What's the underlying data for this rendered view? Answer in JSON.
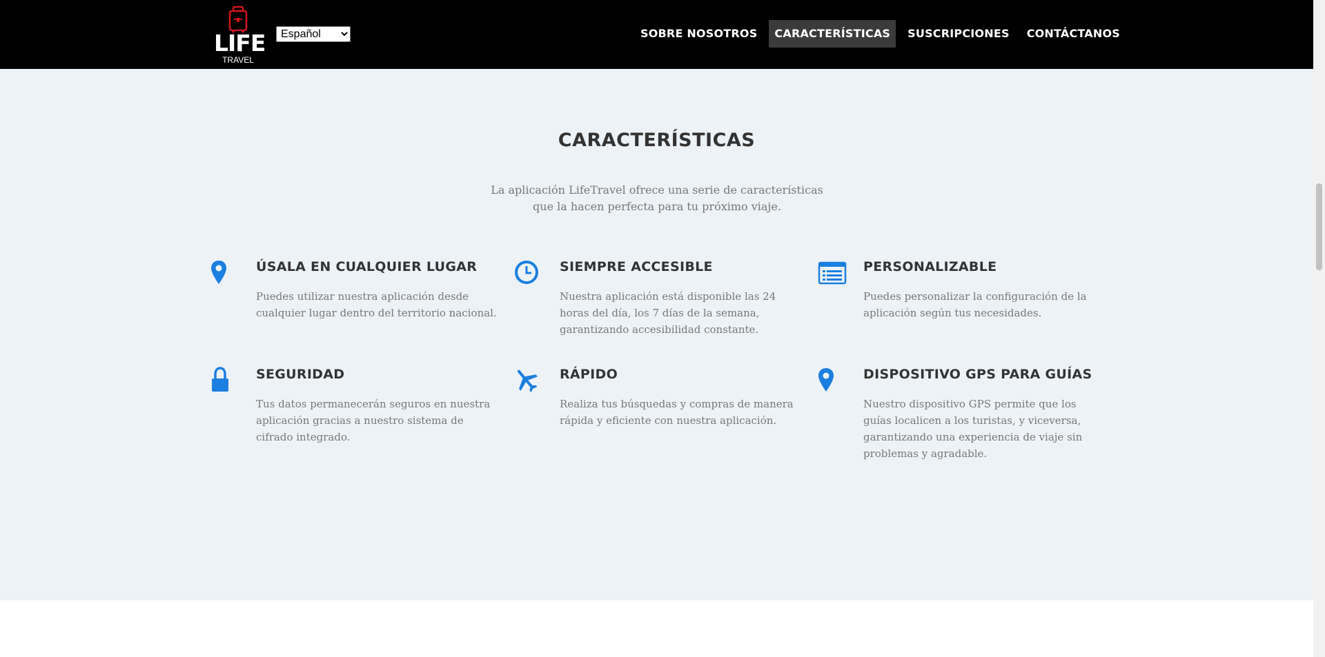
{
  "header": {
    "logo_text": "LIFE",
    "logo_subtext": "TRAVEL",
    "language_select": {
      "selected": "Español",
      "options": [
        "Español"
      ]
    },
    "nav": [
      {
        "label": "SOBRE NOSOTROS",
        "active": false
      },
      {
        "label": "CARACTERÍSTICAS",
        "active": true
      },
      {
        "label": "SUSCRIPCIONES",
        "active": false
      },
      {
        "label": "CONTÁCTANOS",
        "active": false
      }
    ]
  },
  "features_section": {
    "title": "CARACTERÍSTICAS",
    "intro": "La aplicación LifeTravel ofrece una serie de características que la hacen perfecta para tu próximo viaje.",
    "items": [
      {
        "icon": "map-marker-icon",
        "title": "ÚSALA EN CUALQUIER LUGAR",
        "text": "Puedes utilizar nuestra aplicación desde cualquier lugar dentro del territorio nacional."
      },
      {
        "icon": "clock-icon",
        "title": "SIEMPRE ACCESIBLE",
        "text": "Nuestra aplicación está disponible las 24 horas del día, los 7 días de la semana, garantizando accesibilidad constante."
      },
      {
        "icon": "list-icon",
        "title": "PERSONALIZABLE",
        "text": "Puedes personalizar la configuración de la aplicación según tus necesidades."
      },
      {
        "icon": "lock-icon",
        "title": "SEGURIDAD",
        "text": "Tus datos permanecerán seguros en nuestra aplicación gracias a nuestro sistema de cifrado integrado."
      },
      {
        "icon": "plane-icon",
        "title": "RÁPIDO",
        "text": "Realiza tus búsquedas y compras de manera rápida y eficiente con nuestra aplicación."
      },
      {
        "icon": "map-marker-icon",
        "title": "DISPOSITIVO GPS PARA GUÍAS",
        "text": "Nuestro dispositivo GPS permite que los guías localicen a los turistas, y viceversa, garantizando una experiencia de viaje sin problemas y agradable."
      }
    ]
  },
  "colors": {
    "header_bg": "#000000",
    "nav_active_bg": "#3b3b3b",
    "section_bg": "#edf2f6",
    "icon_accent": "#1b7fe0",
    "logo_accent": "#d1141c"
  }
}
